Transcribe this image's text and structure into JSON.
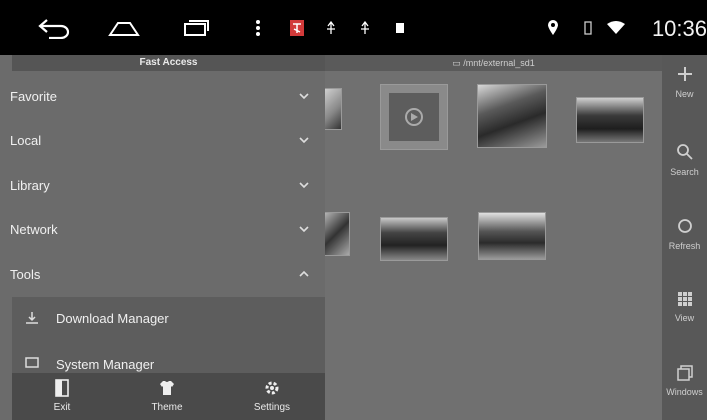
{
  "status": {
    "time": "10:36"
  },
  "path": "/mnt/external_sd1",
  "drawer": {
    "title": "Fast Access",
    "sections": [
      {
        "label": "Favorite",
        "expanded": false
      },
      {
        "label": "Local",
        "expanded": false
      },
      {
        "label": "Library",
        "expanded": false
      },
      {
        "label": "Network",
        "expanded": false
      },
      {
        "label": "Tools",
        "expanded": true
      }
    ],
    "tools": [
      {
        "label": "Download Manager",
        "icon": "download-icon"
      },
      {
        "label": "System Manager",
        "icon": "system-manager-icon"
      }
    ],
    "footer": [
      {
        "label": "Exit",
        "icon": "exit-icon"
      },
      {
        "label": "Theme",
        "icon": "theme-icon"
      },
      {
        "label": "Settings",
        "icon": "gear-icon"
      }
    ]
  },
  "actions": [
    {
      "label": "New",
      "icon": "plus-icon"
    },
    {
      "label": "Search",
      "icon": "search-icon"
    },
    {
      "label": "Refresh",
      "icon": "refresh-icon"
    },
    {
      "label": "View",
      "icon": "grid-icon"
    },
    {
      "label": "Windows",
      "icon": "windows-icon"
    }
  ],
  "colors": {
    "drawer_bg": "#6b6b6b",
    "statusbar_bg": "#000000",
    "actionbar_bg": "#585858"
  }
}
